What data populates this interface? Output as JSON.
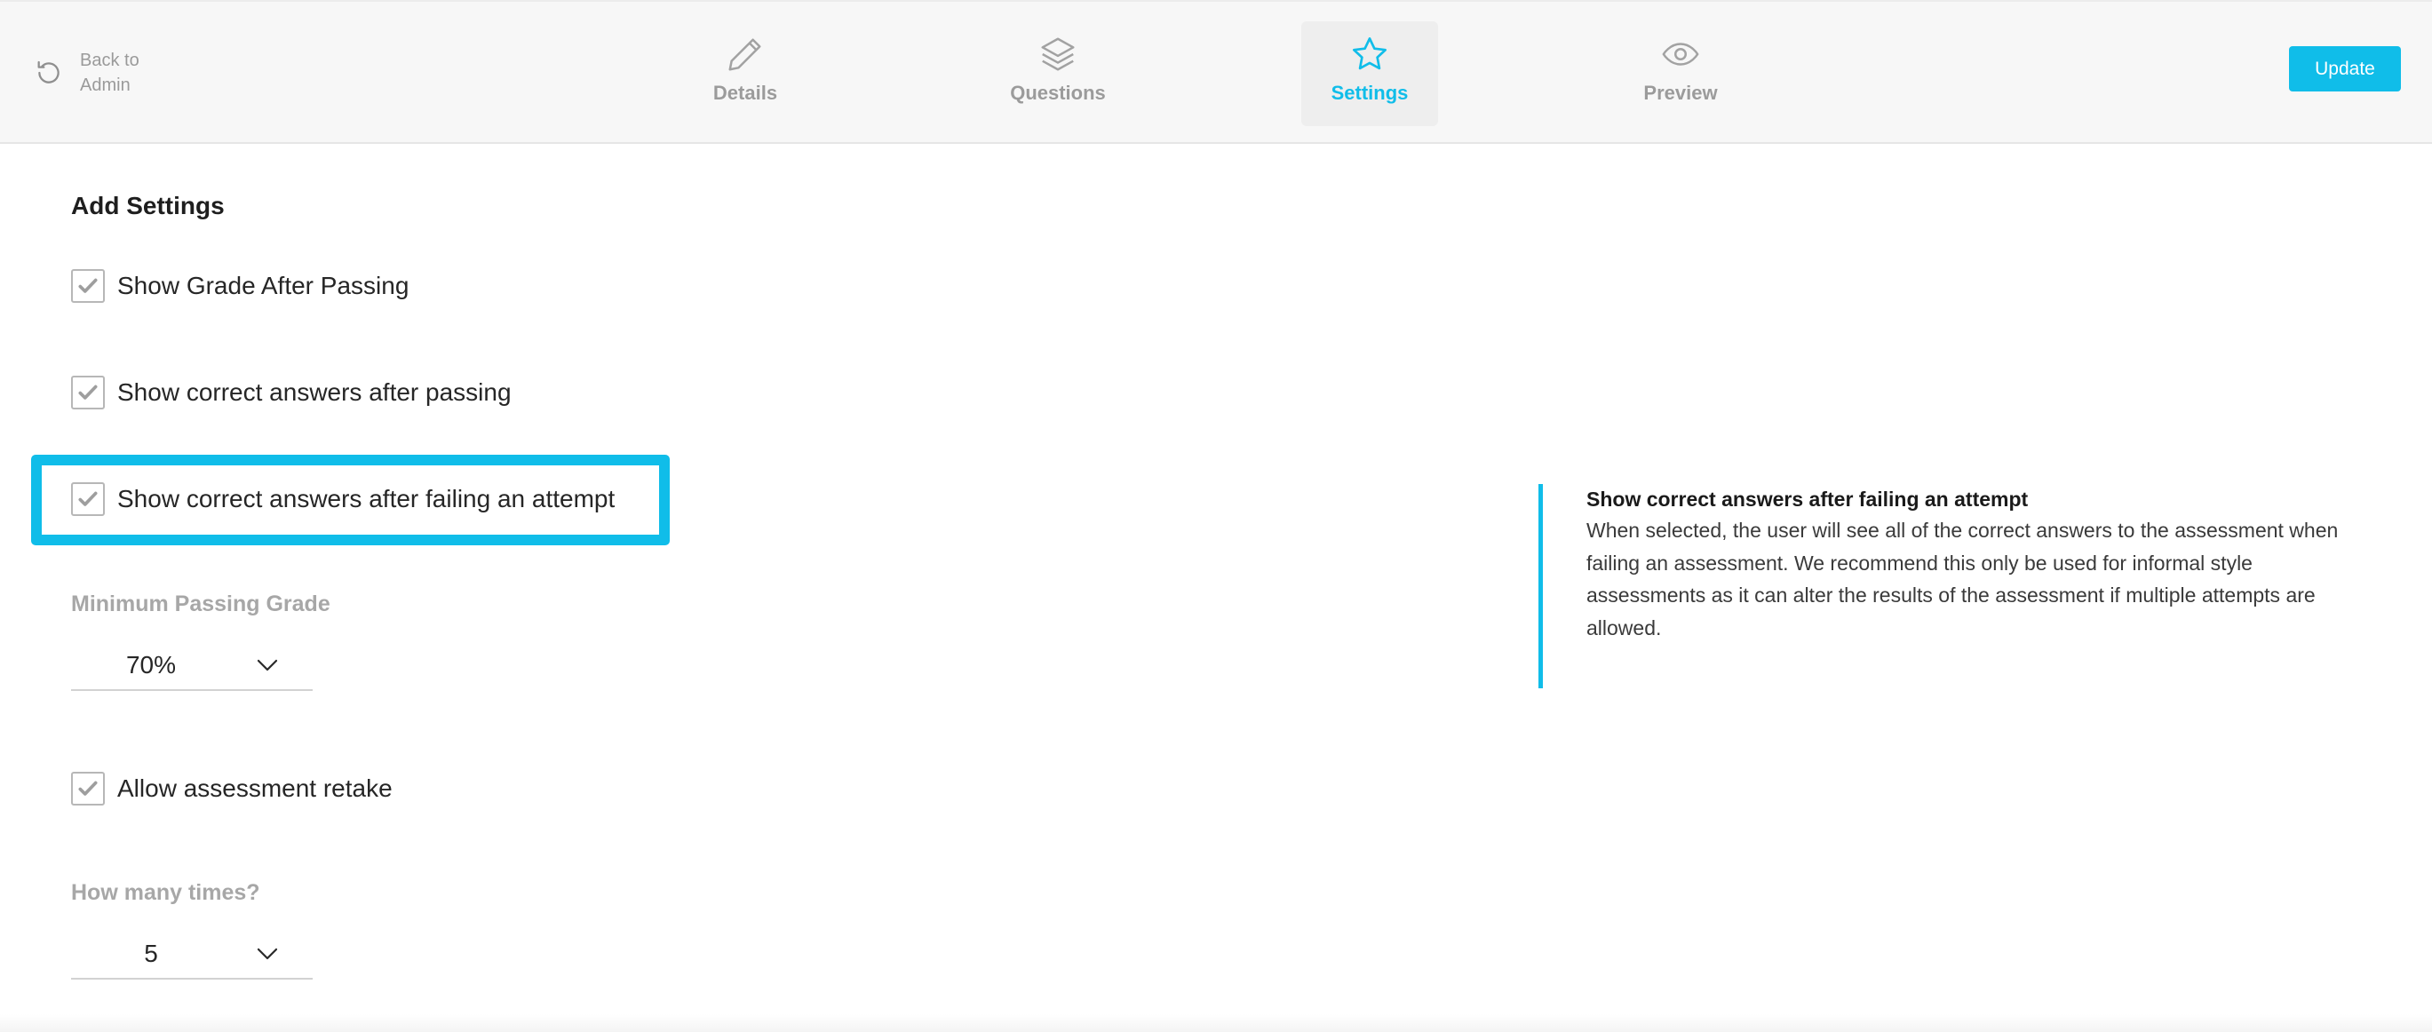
{
  "header": {
    "back_label": "Back to Admin",
    "tabs": [
      {
        "label": "Details",
        "icon": "pencil-icon",
        "active": false
      },
      {
        "label": "Questions",
        "icon": "layers-icon",
        "active": false
      },
      {
        "label": "Settings",
        "icon": "star-icon",
        "active": true
      },
      {
        "label": "Preview",
        "icon": "eye-icon",
        "active": false
      }
    ],
    "update_label": "Update"
  },
  "settings": {
    "title": "Add Settings",
    "options": [
      {
        "label": "Show Grade After Passing",
        "checked": true
      },
      {
        "label": "Show correct answers after passing",
        "checked": true
      },
      {
        "label": "Show correct answers after failing an attempt",
        "checked": true,
        "highlighted": true
      },
      {
        "label": "Allow assessment retake",
        "checked": true
      }
    ],
    "min_grade": {
      "label": "Minimum Passing Grade",
      "value": "70%"
    },
    "retake_times": {
      "label": "How many times?",
      "value": "5"
    }
  },
  "help": {
    "title": "Show correct answers after failing an attempt",
    "body": "When selected, the user will see all of the correct answers to the assessment when failing an assessment. We recommend this only be used for informal style assessments as it can alter the results of the assessment if multiple attempts are allowed."
  },
  "colors": {
    "accent": "#10bde9",
    "header_bg": "#f7f7f7",
    "muted_text": "#9b9b9b"
  }
}
